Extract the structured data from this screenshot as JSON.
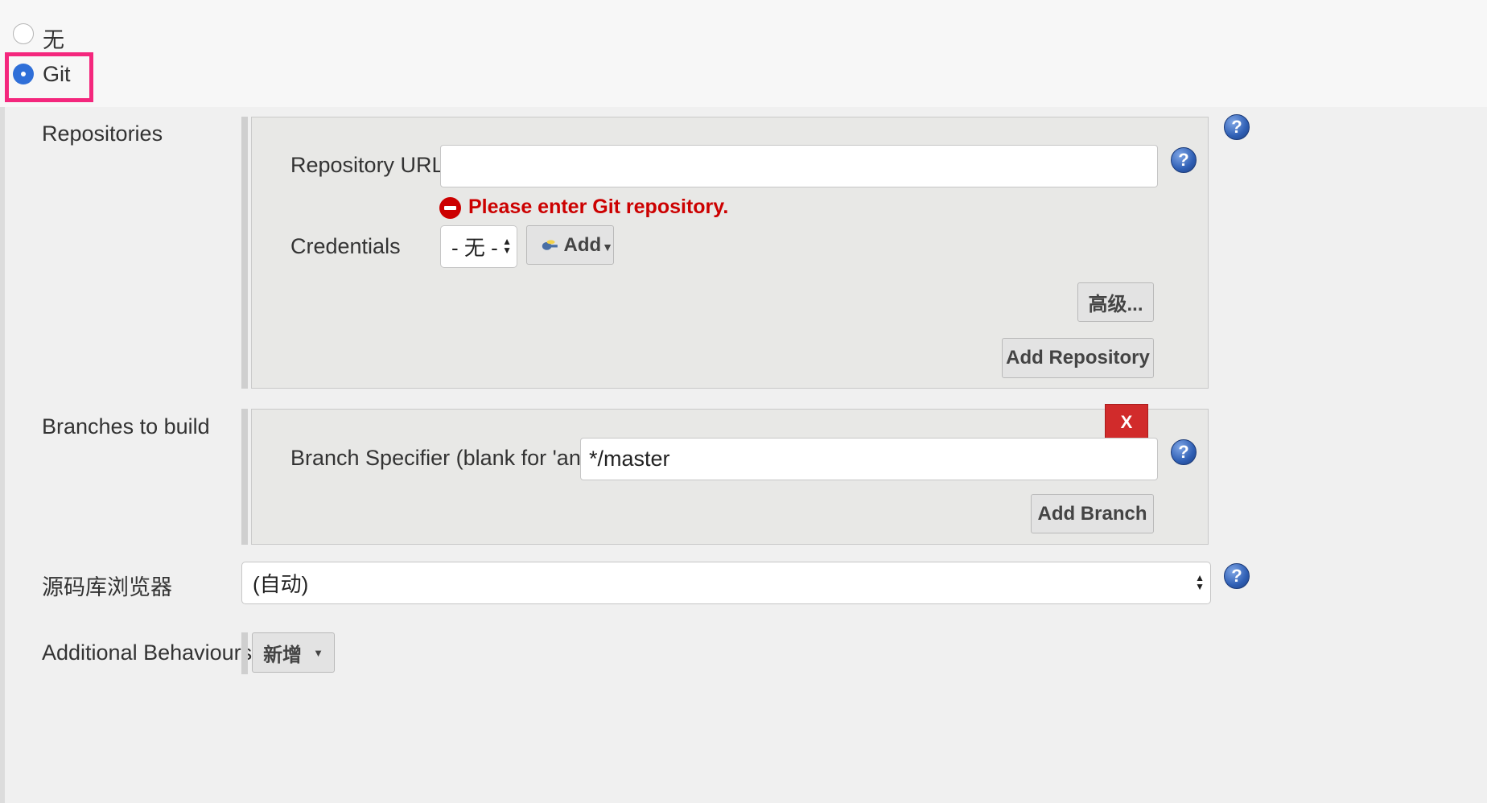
{
  "scm": {
    "option_none_label": "无",
    "option_git_label": "Git"
  },
  "repositories": {
    "section_label": "Repositories",
    "repo_url_label": "Repository URL",
    "repo_url_value": "",
    "error_message": "Please enter Git repository.",
    "credentials_label": "Credentials",
    "credentials_selected": "- 无 -",
    "add_credentials_label": "Add",
    "advanced_label": "高级...",
    "add_repository_label": "Add Repository"
  },
  "branches": {
    "section_label": "Branches to build",
    "delete_label": "X",
    "specifier_label": "Branch Specifier (blank for 'any')",
    "specifier_value": "*/master",
    "add_branch_label": "Add Branch"
  },
  "browser": {
    "section_label": "源码库浏览器",
    "selected": "(自动)"
  },
  "behaviours": {
    "section_label": "Additional Behaviours",
    "add_label": "新增"
  },
  "icons": {
    "help": "help-icon",
    "error": "error-icon",
    "key": "key-icon"
  },
  "colors": {
    "error": "#cc0000",
    "highlight": "#f4277d",
    "radio_selected": "#2f6fd8",
    "delete_button": "#d12b2b"
  }
}
